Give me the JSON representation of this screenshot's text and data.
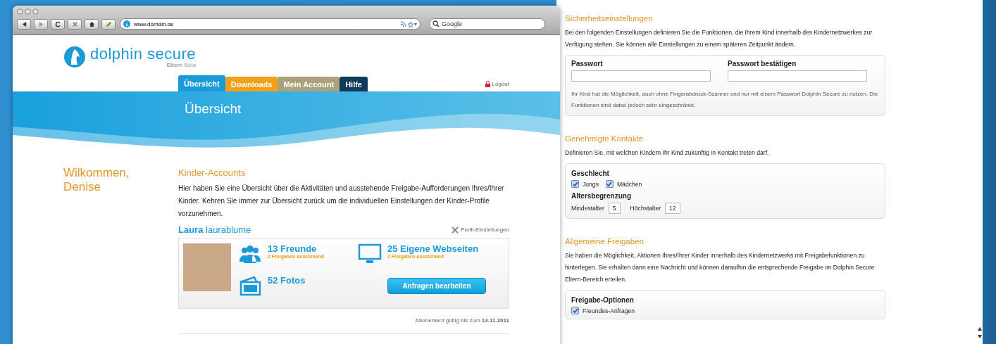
{
  "browser": {
    "url": "www.domain.de",
    "search_placeholder": "Google"
  },
  "site": {
    "logo": "dolphin secure",
    "logo_sub": "**Eltern** Beta",
    "tabs": [
      {
        "label": "Übersicht",
        "selected": true,
        "color": "#1a9ad8"
      },
      {
        "label": "Downloads",
        "selected": false,
        "color": "#f0a019"
      },
      {
        "label": "Mein Account",
        "selected": false,
        "color": "#a9a27c"
      },
      {
        "label": "Hilfe",
        "selected": false,
        "color": "#0f3a5c"
      }
    ],
    "logout": "Logout",
    "banner_title": "Übersicht",
    "welcome": "Wilkommen, Denise",
    "kinder": {
      "heading": "Kinder-Accounts",
      "text": "Hier haben Sie eine Übersicht über die Aktivitäten und ausstehende Freigabe-Aufforderungen Ihres/Ihrer Kinder. Kehren Sie immer zur Übersicht zurück um die individuellen Einstellungen der Kinder-Profile vorzunehmen.",
      "child": "**Laura** laurablume",
      "profile_link": "Profil-Einstellungen",
      "stats": [
        {
          "kind": "friends",
          "value": "13 Freunde",
          "sub": "2 Freigaben ausstehend"
        },
        {
          "kind": "websites",
          "value": "25 Eigene Webseiten",
          "sub": "2 Freigaben ausstehend"
        },
        {
          "kind": "photos",
          "value": "52 Fotos"
        }
      ],
      "button": "Anfragen bearbeiten",
      "subscription": "Abonement gültig bis zum **13.11.2011**"
    }
  },
  "settings": [
    {
      "heading": "Sicherheitseinstellungen",
      "text": "Bei den folgenden Einstellungen definieren Sie die Funktionen, die Ihrem Kind innerhalb des Kindernetzwerkes zur Verfügung stehen. Sie können alle Einstellungen zu einem späteren Zeitpunkt ändern.",
      "items": [
        {
          "kind": "fields",
          "fields": [
            {
              "label": "Passwort"
            },
            {
              "label": "Passwort bestätigen"
            }
          ]
        },
        {
          "kind": "note",
          "text": "Ihr Kind hat die Möglichkeit, auch ohne Fingerabdruck-Scanner und nur mit einem Passwort Dolphin Secure zu nutzen. Die Funktionen sind dabei jedoch sehr eingeschränkt."
        }
      ]
    },
    {
      "heading": "Genehmigte Kontakte",
      "text": "Definieren Sie, mit welchen Kindern Ihr Kind zukünftig in Kontakt treten darf.",
      "items": [
        {
          "kind": "label",
          "text": "Geschlecht"
        },
        {
          "kind": "checkboxes",
          "options": [
            {
              "label": "Jungs",
              "checked": true
            },
            {
              "label": "Mädchen",
              "checked": true
            }
          ]
        },
        {
          "kind": "label",
          "text": "Altersbegrenzung"
        },
        {
          "kind": "numbers",
          "fields": [
            {
              "label": "Mindestalter",
              "value": "5"
            },
            {
              "label": "Höchstalter",
              "value": "12"
            }
          ]
        }
      ]
    },
    {
      "heading": "Allgemeine Freigaben",
      "text": "Sie haben die Möglichkeit, Aktionen Ihres/Ihrer Kinder innerhalb des Kindernetzwerks mit Freigabefunktionen zu hinterlegen. Sie erhalten dann eine Nachricht und können daraufhin die entsprechende Freigabe im Dolphin Secure Eltern-Bereich erteilen.",
      "items": [
        {
          "kind": "label",
          "text": "Freigabe-Optionen"
        },
        {
          "kind": "checkboxes",
          "options": [
            {
              "label": "Freundes-Anfragen",
              "checked": true
            }
          ]
        }
      ]
    }
  ]
}
